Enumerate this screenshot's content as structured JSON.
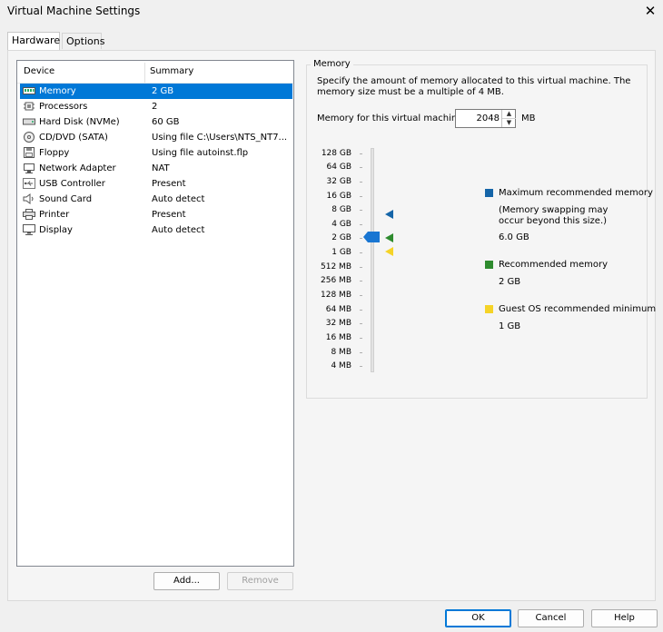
{
  "window": {
    "title": "Virtual Machine Settings",
    "close_glyph": "✕"
  },
  "tabs": [
    {
      "label": "Hardware"
    },
    {
      "label": "Options"
    }
  ],
  "device_list": {
    "header_device": "Device",
    "header_summary": "Summary",
    "rows": [
      {
        "name": "Memory",
        "summary": "2 GB",
        "icon": "memory-icon",
        "selected": true
      },
      {
        "name": "Processors",
        "summary": "2",
        "icon": "processor-icon"
      },
      {
        "name": "Hard Disk (NVMe)",
        "summary": "60 GB",
        "icon": "hard-disk-icon"
      },
      {
        "name": "CD/DVD (SATA)",
        "summary": "Using file C:\\Users\\NTS_NT7...",
        "icon": "cd-dvd-icon"
      },
      {
        "name": "Floppy",
        "summary": "Using file autoinst.flp",
        "icon": "floppy-icon"
      },
      {
        "name": "Network Adapter",
        "summary": "NAT",
        "icon": "network-adapter-icon"
      },
      {
        "name": "USB Controller",
        "summary": "Present",
        "icon": "usb-icon"
      },
      {
        "name": "Sound Card",
        "summary": "Auto detect",
        "icon": "speaker-icon"
      },
      {
        "name": "Printer",
        "summary": "Present",
        "icon": "printer-icon"
      },
      {
        "name": "Display",
        "summary": "Auto detect",
        "icon": "display-icon"
      }
    ]
  },
  "list_buttons": {
    "add": "Add...",
    "remove": "Remove"
  },
  "memory": {
    "group_title": "Memory",
    "description": "Specify the amount of memory allocated to this virtual machine. The memory size must be a multiple of 4 MB.",
    "field_label": "Memory for this virtual machine:",
    "value": "2048",
    "unit": "MB",
    "scale_labels": [
      "128 GB",
      "64 GB",
      "32 GB",
      "16 GB",
      "8 GB",
      "4 GB",
      "2 GB",
      "1 GB",
      "512 MB",
      "256 MB",
      "128 MB",
      "64 MB",
      "32 MB",
      "16 MB",
      "8 MB",
      "4 MB"
    ],
    "slider_value": "2 GB",
    "legend": {
      "max_title": "Maximum recommended memory",
      "max_note": "(Memory swapping may occur beyond this size.)",
      "max_value": "6.0 GB",
      "rec_title": "Recommended memory",
      "rec_value": "2 GB",
      "min_title": "Guest OS recommended minimum",
      "min_value": "1 GB"
    },
    "colors": {
      "max": "#1565a8",
      "recommended": "#2e8b2e",
      "minimum": "#f5d327",
      "thumb": "#1976d2"
    }
  },
  "dialog_buttons": {
    "ok": "OK",
    "cancel": "Cancel",
    "help": "Help"
  }
}
